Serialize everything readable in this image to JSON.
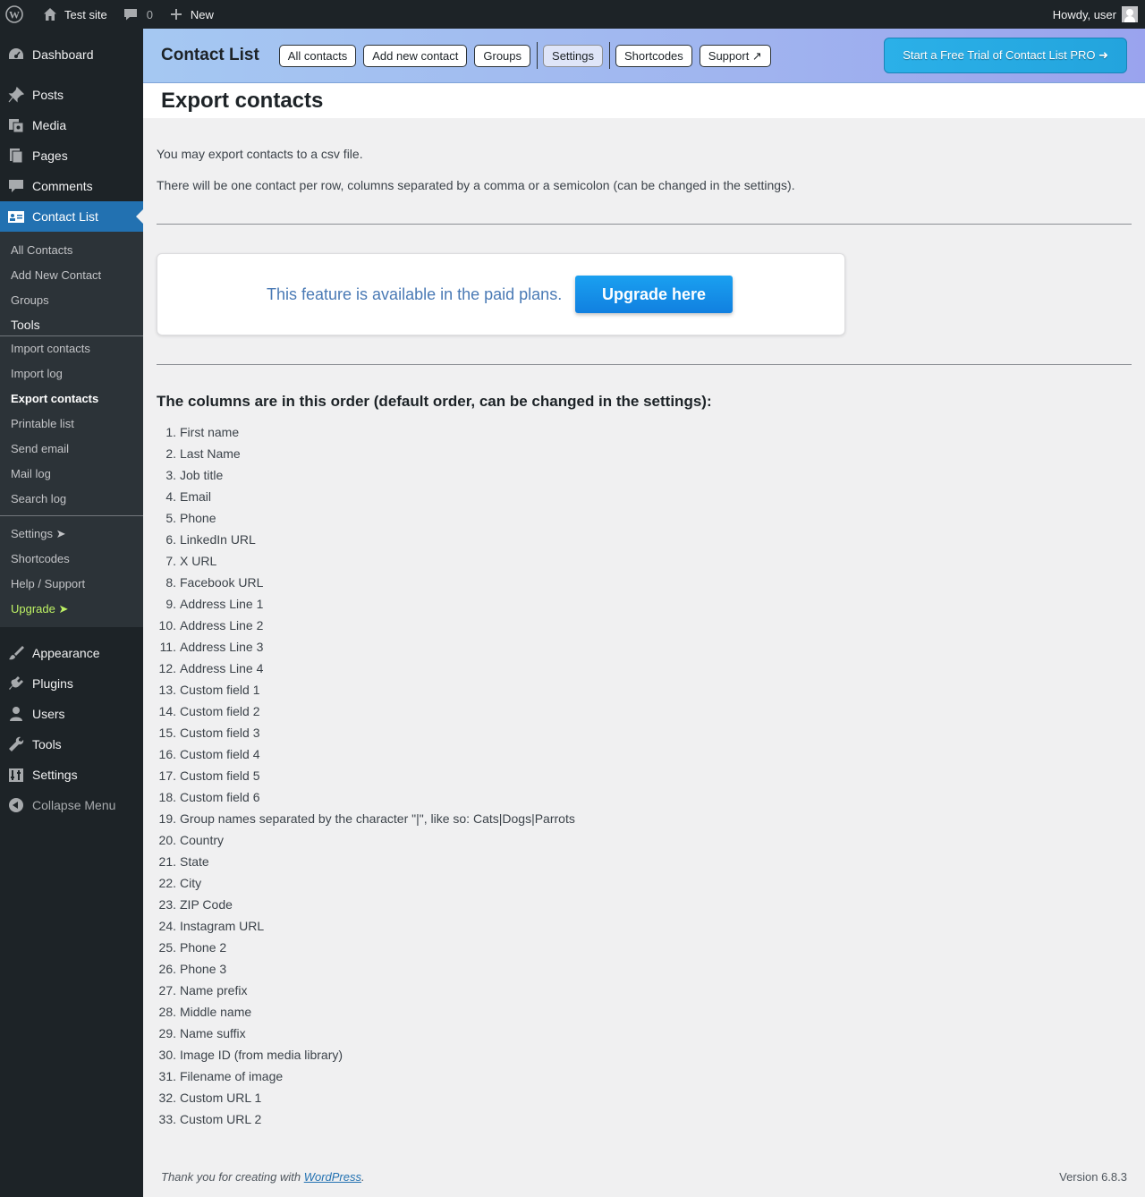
{
  "admin_bar": {
    "site_name": "Test site",
    "comments_count": "0",
    "new_label": "New",
    "howdy": "Howdy, user"
  },
  "sidebar": {
    "top_items": [
      {
        "label": "Dashboard",
        "icon": "dashboard-icon"
      },
      {
        "label": "Posts",
        "icon": "pushpin-icon"
      },
      {
        "label": "Media",
        "icon": "media-icon"
      },
      {
        "label": "Pages",
        "icon": "pages-icon"
      },
      {
        "label": "Comments",
        "icon": "comment-icon"
      },
      {
        "label": "Contact List",
        "icon": "contact-card-icon",
        "current": true
      }
    ],
    "submenu": {
      "items_a": [
        "All Contacts",
        "Add New Contact",
        "Groups"
      ],
      "tools_heading": "Tools",
      "items_b": [
        "Import contacts",
        "Import log",
        "Export contacts",
        "Printable list",
        "Send email",
        "Mail log",
        "Search log"
      ],
      "settings": "Settings ➤",
      "shortcodes": "Shortcodes",
      "help": "Help / Support",
      "upgrade": "Upgrade ➤"
    },
    "bottom_items": [
      {
        "label": "Appearance",
        "icon": "paintbrush-icon"
      },
      {
        "label": "Plugins",
        "icon": "plugin-icon"
      },
      {
        "label": "Users",
        "icon": "user-icon"
      },
      {
        "label": "Tools",
        "icon": "wrench-icon"
      },
      {
        "label": "Settings",
        "icon": "settings-sliders-icon"
      }
    ],
    "collapse": "Collapse Menu"
  },
  "header": {
    "title": "Contact List",
    "nav": [
      "All contacts",
      "Add new contact",
      "Groups",
      "Settings",
      "Shortcodes",
      "Support ↗"
    ],
    "trial_button": "Start a Free Trial of Contact List PRO ➜"
  },
  "page": {
    "title": "Export contacts",
    "intro_1": "You may export contacts to a csv file.",
    "intro_2": "There will be one contact per row, columns separated by a comma or a semicolon (can be changed in the settings).",
    "feature_msg": "This feature is available in the paid plans.",
    "upgrade_button": "Upgrade here",
    "columns_heading": "The columns are in this order (default order, can be changed in the settings):",
    "columns": [
      "First name",
      "Last Name",
      "Job title",
      "Email",
      "Phone",
      "LinkedIn URL",
      "X URL",
      "Facebook URL",
      "Address Line 1",
      "Address Line 2",
      "Address Line 3",
      "Address Line 4",
      "Custom field 1",
      "Custom field 2",
      "Custom field 3",
      "Custom field 4",
      "Custom field 5",
      "Custom field 6",
      "Group names separated by the character \"|\", like so: Cats|Dogs|Parrots",
      "Country",
      "State",
      "City",
      "ZIP Code",
      "Instagram URL",
      "Phone 2",
      "Phone 3",
      "Name prefix",
      "Middle name",
      "Name suffix",
      "Image ID (from media library)",
      "Filename of image",
      "Custom URL 1",
      "Custom URL 2"
    ]
  },
  "footer": {
    "thanks_prefix": "Thank you for creating with ",
    "thanks_link": "WordPress",
    "thanks_suffix": ".",
    "version": "Version 6.8.3"
  }
}
